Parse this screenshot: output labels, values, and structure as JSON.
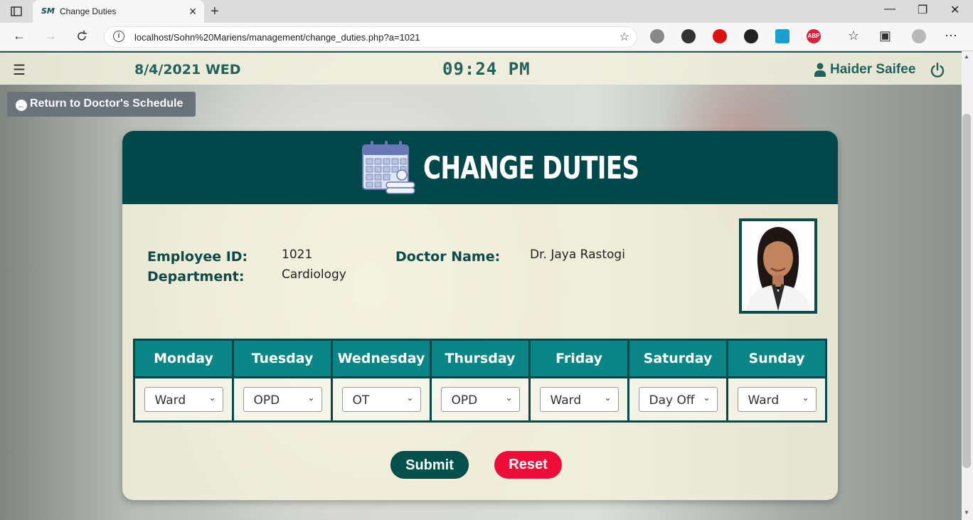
{
  "browser": {
    "tab_favicon": "SM",
    "tab_title": "Change Duties",
    "tab_close": "✕",
    "new_tab": "+",
    "url": "localhost/Sohn%20Mariens/management/change_duties.php?a=1021",
    "window": {
      "minimize": "—",
      "restore": "❐",
      "close": "✕"
    },
    "extensions": [
      "read-aloud",
      "media",
      "opera",
      "sync",
      "translate",
      "adblock-plus"
    ],
    "adblock_label": "ABP"
  },
  "topbar": {
    "menu_icon": "☰",
    "date": "8/4/2021 WED",
    "time": "09:24 PM",
    "user_name": "Haider Saifee"
  },
  "return_button": {
    "label": "Return to Doctor's Schedule"
  },
  "card": {
    "title": "CHANGE DUTIES",
    "employee_id_label": "Employee ID:",
    "employee_id": "1021",
    "department_label": "Department:",
    "department": "Cardiology",
    "doctor_name_label": "Doctor Name:",
    "doctor_name": "Dr. Jaya Rastogi"
  },
  "schedule": {
    "days": [
      "Monday",
      "Tuesday",
      "Wednesday",
      "Thursday",
      "Friday",
      "Saturday",
      "Sunday"
    ],
    "selected": [
      "Ward",
      "OPD",
      "OT",
      "OPD",
      "Ward",
      "Day Off",
      "Ward"
    ]
  },
  "actions": {
    "submit": "Submit",
    "reset": "Reset"
  },
  "colors": {
    "header": "#02474a",
    "table_header": "#0a8686",
    "accent_text": "#23625c",
    "submit": "#03504d",
    "reset": "#ee0c39"
  }
}
